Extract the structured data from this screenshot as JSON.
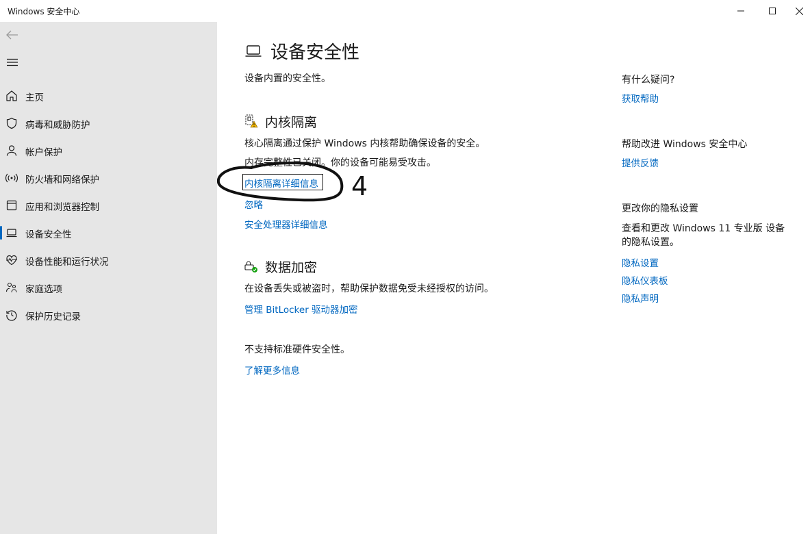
{
  "window": {
    "title": "Windows 安全中心"
  },
  "sidebar": {
    "items": [
      {
        "label": "主页",
        "icon": "home-icon"
      },
      {
        "label": "病毒和威胁防护",
        "icon": "shield-icon"
      },
      {
        "label": "帐户保护",
        "icon": "person-icon"
      },
      {
        "label": "防火墙和网络保护",
        "icon": "wifi-signal-icon"
      },
      {
        "label": "应用和浏览器控制",
        "icon": "app-window-icon"
      },
      {
        "label": "设备安全性",
        "icon": "laptop-icon",
        "active": true
      },
      {
        "label": "设备性能和运行状况",
        "icon": "heart-pulse-icon"
      },
      {
        "label": "家庭选项",
        "icon": "family-icon"
      },
      {
        "label": "保护历史记录",
        "icon": "history-icon"
      }
    ]
  },
  "main": {
    "title": "设备安全性",
    "subtitle": "设备内置的安全性。",
    "core_isolation": {
      "title": "内核隔离",
      "description": "核心隔离通过保护 Windows 内核帮助确保设备的安全。",
      "status": "内存完整性已关闭。你的设备可能易受攻击。",
      "details_link": "内核隔离详细信息",
      "dismiss_link": "忽略",
      "processor_link": "安全处理器详细信息"
    },
    "data_encryption": {
      "title": "数据加密",
      "description": "在设备丢失或被盗时，帮助保护数据免受未经授权的访问。",
      "bitlocker_link": "管理 BitLocker 驱动器加密"
    },
    "hardware": {
      "status": "不支持标准硬件安全性。",
      "learn_more_link": "了解更多信息"
    },
    "annotation_number": "4"
  },
  "aside": {
    "question": {
      "title": "有什么疑问?",
      "link": "获取帮助"
    },
    "improve": {
      "title": "帮助改进 Windows 安全中心",
      "link": "提供反馈"
    },
    "privacy": {
      "title": "更改你的隐私设置",
      "description": "查看和更改 Windows 11 专业版 设备的隐私设置。",
      "links": [
        "隐私设置",
        "隐私仪表板",
        "隐私声明"
      ]
    }
  },
  "colors": {
    "accent": "#0067c0",
    "sidebar_bg": "#e6e6e6",
    "warning": "#f2b600",
    "ok": "#13a10e"
  }
}
